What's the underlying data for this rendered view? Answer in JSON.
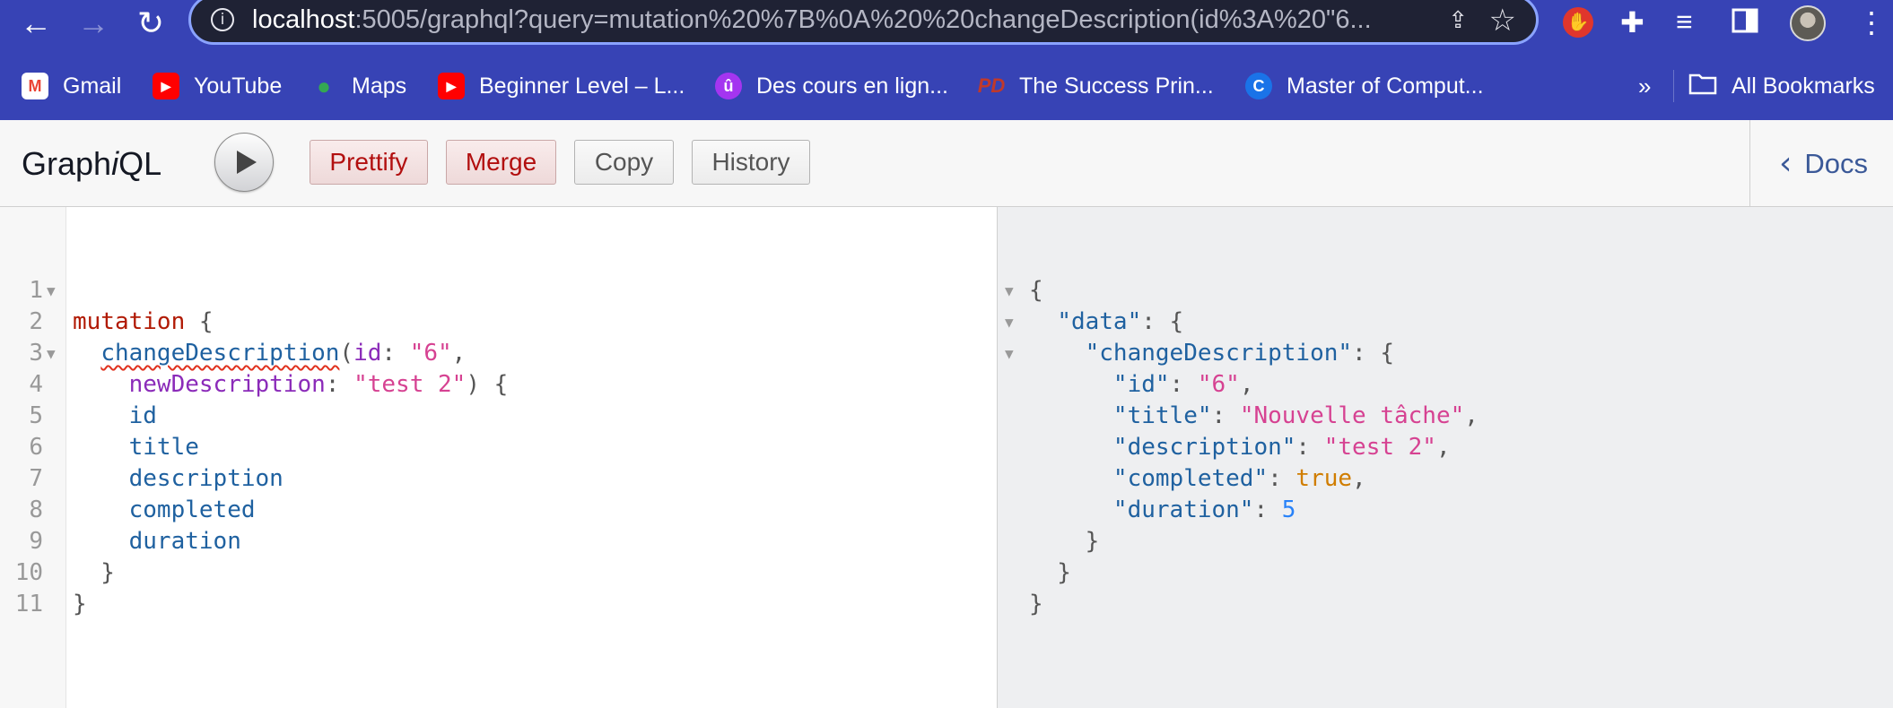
{
  "browser": {
    "url_host": "localhost",
    "url_rest": ":5005/graphql?query=mutation%20%7B%0A%20%20changeDescription(id%3A%20\"6...",
    "back_icon": "←",
    "forward_icon": "→",
    "reload_icon": "↻"
  },
  "bookmarks": [
    {
      "label": "Gmail",
      "icon_text": "M",
      "color": "#ea4335"
    },
    {
      "label": "YouTube",
      "icon_text": "▶",
      "color": "#ff0000"
    },
    {
      "label": "Maps",
      "icon_text": "●",
      "color": "#34a853"
    },
    {
      "label": "Beginner Level – L...",
      "icon_text": "▶",
      "color": "#ff0000"
    },
    {
      "label": "Des cours en lign...",
      "icon_text": "û",
      "color": "#a435f0"
    },
    {
      "label": "The Success Prin...",
      "icon_text": "PD",
      "color": "#c0392b"
    },
    {
      "label": "Master of Comput...",
      "icon_text": "C",
      "color": "#1a73e8"
    }
  ],
  "bookmarks_more": "»",
  "all_bookmarks": "All Bookmarks",
  "toolbar": {
    "title_pre": "Graph",
    "title_i": "i",
    "title_post": "QL",
    "prettify": "Prettify",
    "merge": "Merge",
    "copy": "Copy",
    "history": "History",
    "docs": "Docs"
  },
  "query_lines": [
    {
      "n": "1",
      "fold": true
    },
    {
      "n": "2",
      "fold": false
    },
    {
      "n": "3",
      "fold": true
    },
    {
      "n": "4",
      "fold": false
    },
    {
      "n": "5",
      "fold": false
    },
    {
      "n": "6",
      "fold": false
    },
    {
      "n": "7",
      "fold": false
    },
    {
      "n": "8",
      "fold": false
    },
    {
      "n": "9",
      "fold": false
    },
    {
      "n": "10",
      "fold": false
    },
    {
      "n": "11",
      "fold": false
    }
  ],
  "query": {
    "keyword": "mutation",
    "field": "changeDescription",
    "arg1_name": "id",
    "arg1_value": "\"6\"",
    "arg2_name": "newDescription",
    "arg2_value": "\"test 2\"",
    "selections": [
      "id",
      "title",
      "description",
      "completed",
      "duration"
    ]
  },
  "result": {
    "data_key": "\"data\"",
    "field_key": "\"changeDescription\"",
    "id_key": "\"id\"",
    "id_value": "\"6\"",
    "title_key": "\"title\"",
    "title_value": "\"Nouvelle tâche\"",
    "description_key": "\"description\"",
    "description_value": "\"test 2\"",
    "completed_key": "\"completed\"",
    "completed_value": "true",
    "duration_key": "\"duration\"",
    "duration_value": "5"
  }
}
